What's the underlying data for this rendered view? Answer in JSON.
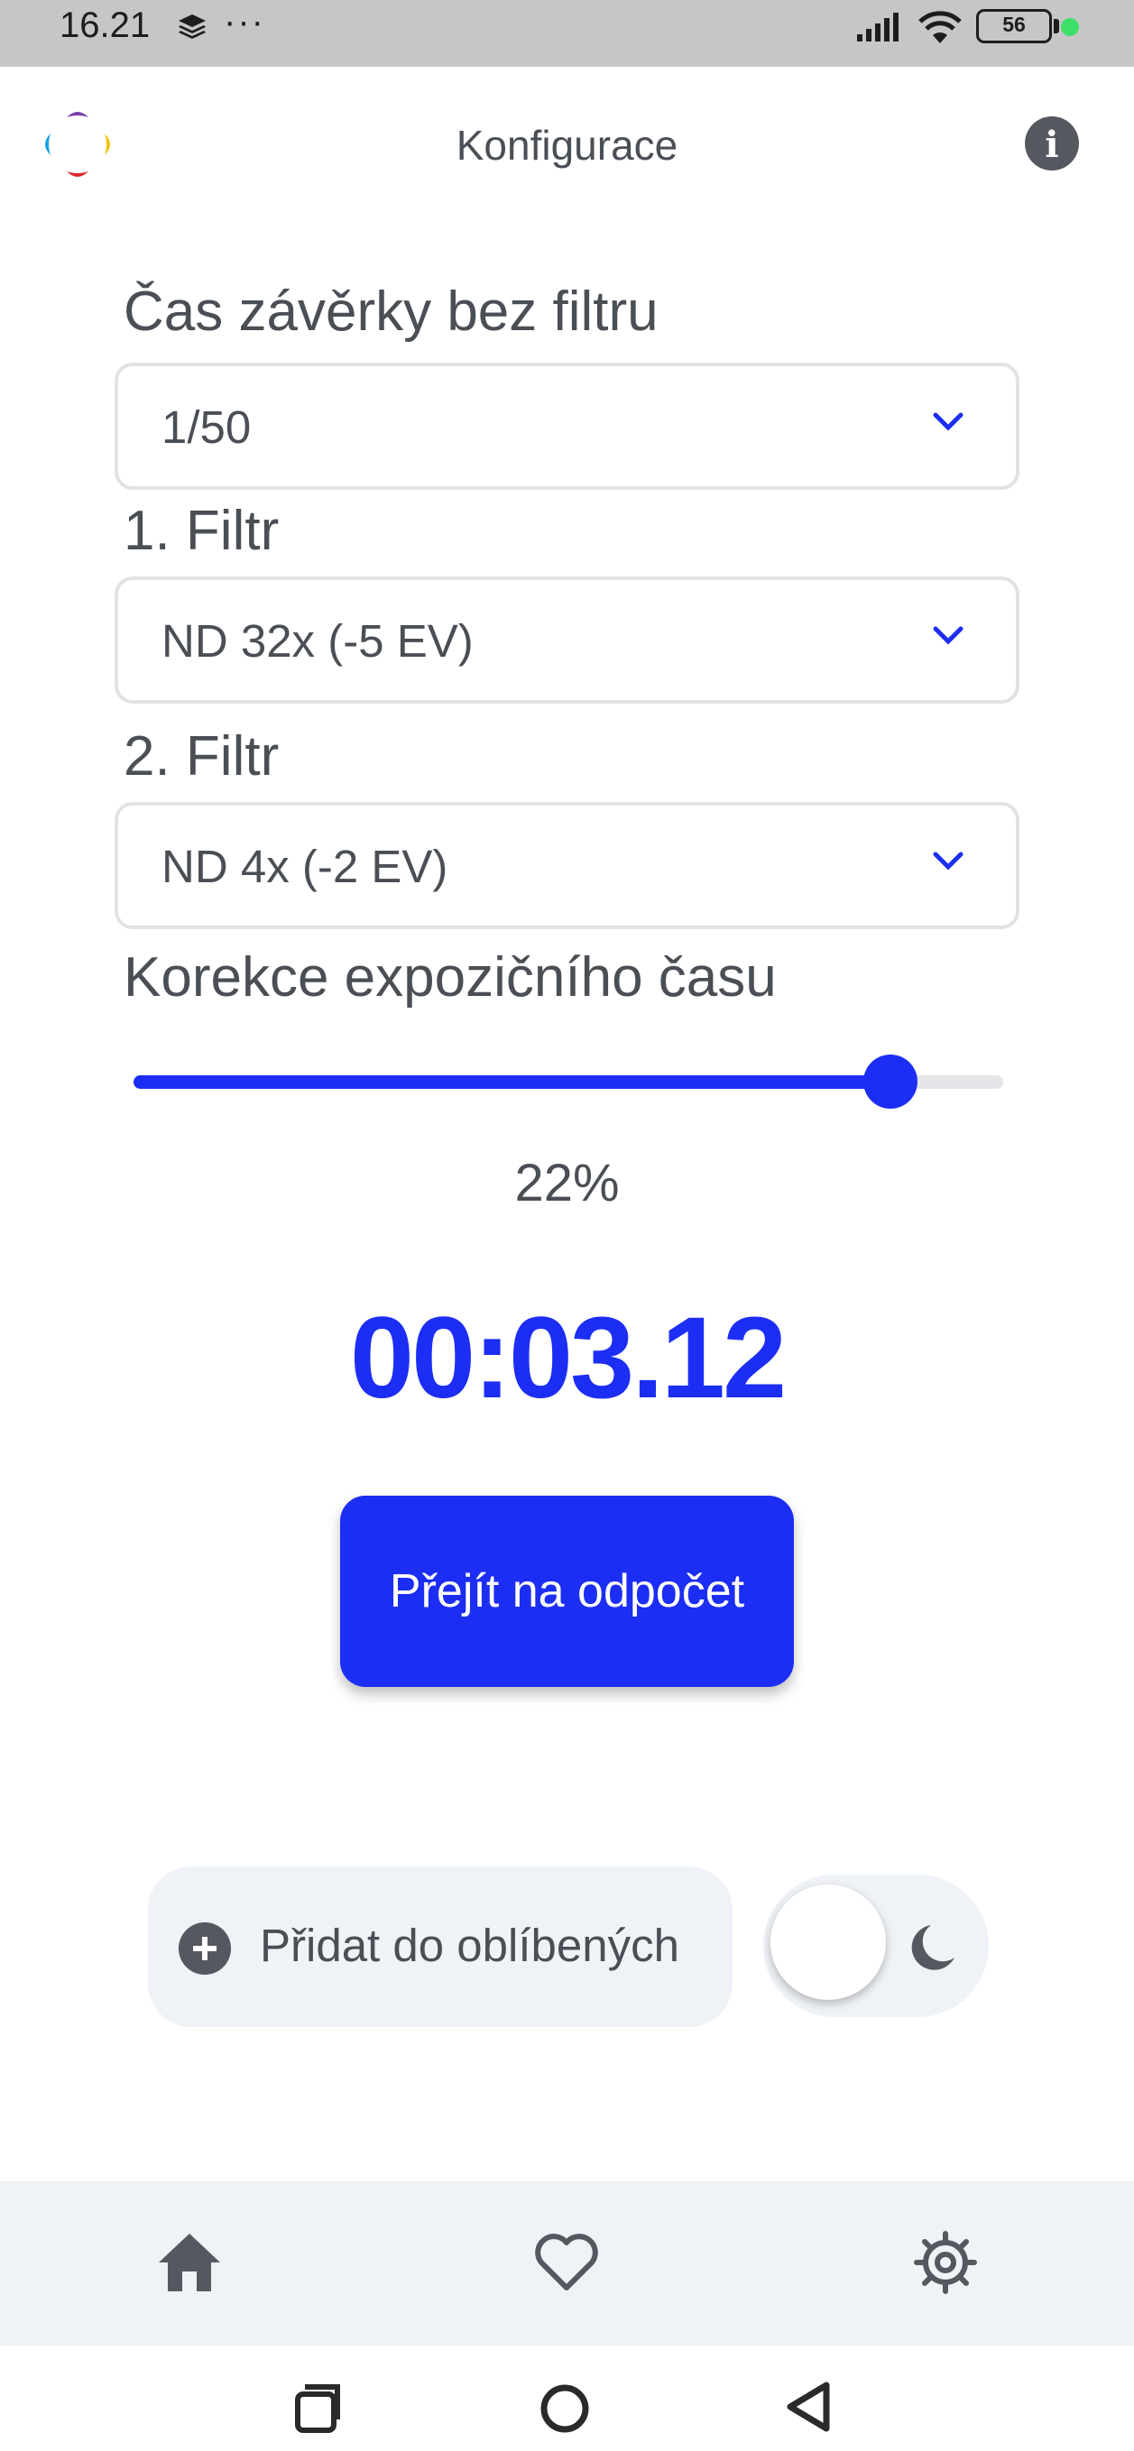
{
  "status_bar": {
    "time": "16.21",
    "more": "···",
    "battery": "56",
    "charging_dot_color": "#3ee06a"
  },
  "header": {
    "title": "Konfigurace",
    "info_label": "i"
  },
  "form": {
    "shutter_label": "Čas závěrky bez filtru",
    "shutter_value": "1/50",
    "filter1_label": "1. Filtr",
    "filter1_value": "ND 32x (-5 EV)",
    "filter2_label": "2. Filtr",
    "filter2_value": "ND 4x (-2 EV)",
    "correction_label": "Korekce expozičního času",
    "correction_slider_level": 0.87,
    "correction_value": "22%"
  },
  "result": {
    "time": "00:03.12"
  },
  "actions": {
    "countdown_button": "Přejít na odpočet",
    "favorite_button": "Přidat do oblíbených",
    "dark_mode_toggle_on": false
  },
  "bottom_nav": {
    "items": [
      "home-icon",
      "heart-icon",
      "gear-icon"
    ],
    "active": "home-icon"
  },
  "system_nav": [
    "recents-icon",
    "home-circle-icon",
    "back-icon"
  ],
  "colors": {
    "accent": "#1c2ef3",
    "text": "#4a4f55",
    "surface": "#eff2f6"
  }
}
